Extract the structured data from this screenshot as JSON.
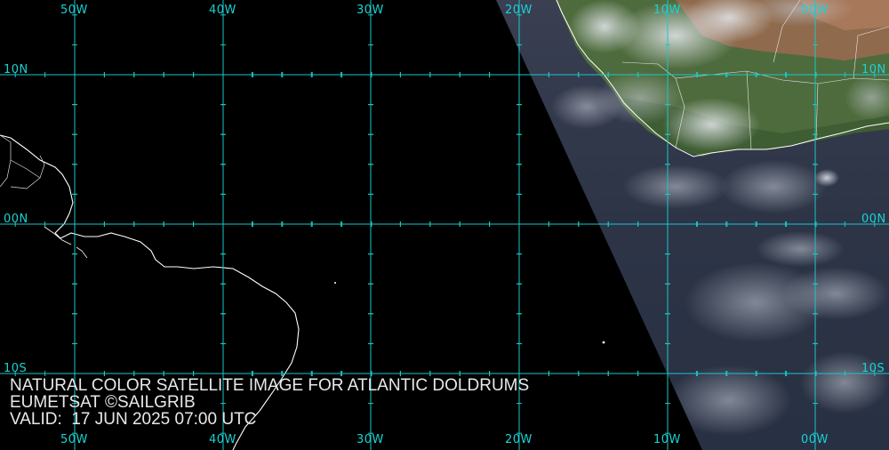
{
  "map": {
    "longitude_labels": [
      "50W",
      "40W",
      "30W",
      "20W",
      "10W",
      "00W"
    ],
    "latitude_labels": [
      "10N",
      "00N",
      "10S"
    ],
    "colors": {
      "grid": "#19c8c8",
      "coastline": "#ffffff",
      "night_side": "#000000",
      "ocean_day": "#2f3646",
      "land_day": "#4d6a3c",
      "desert": "#9a6a4c",
      "cloud": "#dfe3ea"
    }
  },
  "caption": {
    "line1": "NATURAL COLOR SATELLITE IMAGE FOR ATLANTIC DOLDRUMS",
    "line2": "EUMETSAT ©SAILGRIB",
    "line3": "VALID:  17 JUN 2025 07:00 UTC"
  }
}
